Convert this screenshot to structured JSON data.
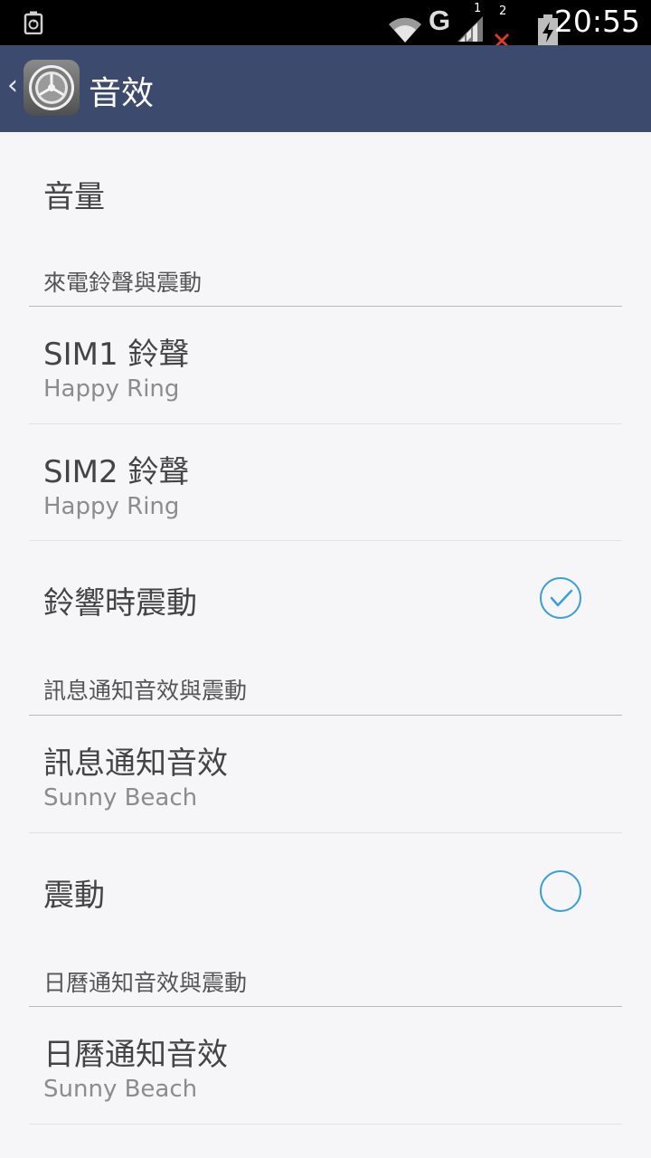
{
  "status_bar": {
    "network": "G",
    "sim1_label": "1",
    "sim2_label": "2",
    "time": "20:55"
  },
  "action_bar": {
    "title": "音效",
    "back_icon": "chevron-left-icon",
    "app_icon": "settings-gear-icon"
  },
  "items": {
    "volume": {
      "title": "音量"
    },
    "section_ring": "來電鈴聲與震動",
    "sim1_ringtone": {
      "title": "SIM1 鈴聲",
      "value": "Happy Ring"
    },
    "sim2_ringtone": {
      "title": "SIM2 鈴聲",
      "value": "Happy Ring"
    },
    "vibrate_on_ring": {
      "title": "鈴響時震動",
      "checked": true
    },
    "section_message": "訊息通知音效與震動",
    "message_sound": {
      "title": "訊息通知音效",
      "value": "Sunny Beach"
    },
    "message_vibrate": {
      "title": "震動",
      "checked": false
    },
    "section_calendar": "日曆通知音效與震動",
    "calendar_sound": {
      "title": "日曆通知音效",
      "value": "Sunny Beach"
    }
  },
  "colors": {
    "action_bar": "#3c4a6e",
    "accent": "#3aa0d8",
    "background": "#f6f6f8"
  }
}
